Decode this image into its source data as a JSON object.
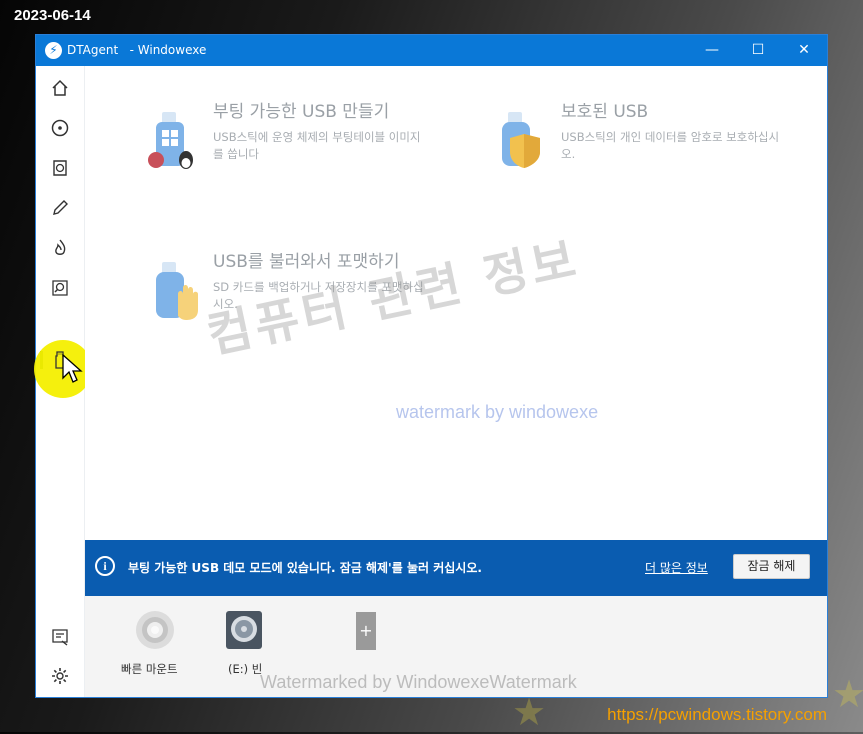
{
  "overlay": {
    "date": "2023-06-14",
    "url": "https://pcwindows.tistory.com",
    "watermark_main": "컴퓨터 관련 정보",
    "watermark_sub": "watermark by windowexe",
    "watermark_bottom": "Watermarked by WindowexeWatermark"
  },
  "window": {
    "app_name": "DTAgent",
    "title_suffix": "- Windowexe",
    "minimize": "—",
    "maximize": "☐",
    "close": "✕"
  },
  "sidebar": {
    "items": [
      {
        "name": "home-icon"
      },
      {
        "name": "disc-icon"
      },
      {
        "name": "disc-image-icon"
      },
      {
        "name": "pencil-icon"
      },
      {
        "name": "flame-icon"
      },
      {
        "name": "search-disc-icon"
      },
      {
        "name": "usb-icon",
        "active": true
      }
    ],
    "bottom_items": [
      {
        "name": "image-text-icon"
      },
      {
        "name": "gear-icon"
      }
    ]
  },
  "cards": [
    {
      "title": "부팅 가능한 USB 만들기",
      "desc": "USB스틱에 운영 체제의 부팅테이블 이미지를 씁니다",
      "icon": "bootable-usb-icon"
    },
    {
      "title": "보호된 USB",
      "desc": "USB스틱의 개인 데이터를 암호로 보호하십시오.",
      "icon": "protected-usb-icon"
    },
    {
      "title": "USB를 불러와서 포맷하기",
      "desc": "SD 카드를 백업하거나 저장장치를 포맷하십시오.",
      "icon": "format-usb-icon"
    }
  ],
  "banner": {
    "text": "부팅 가능한 USB 데모 모드에 있습니다. 잠금 해제'를 눌러 커십시오.",
    "more_link": "더 많은 정보",
    "unlock_button": "잠금 해제"
  },
  "drives": [
    {
      "label": "빠른 마운트",
      "icon": "quick-mount-disc-icon"
    },
    {
      "label": "(E:) 빈",
      "icon": "empty-drive-icon"
    },
    {
      "label": "",
      "icon": "add-drive-icon"
    }
  ],
  "colors": {
    "accent": "#0a78d7",
    "banner": "#0a5cb0",
    "active_indicator": "#2f7d1a",
    "url_text": "#f5a000"
  }
}
